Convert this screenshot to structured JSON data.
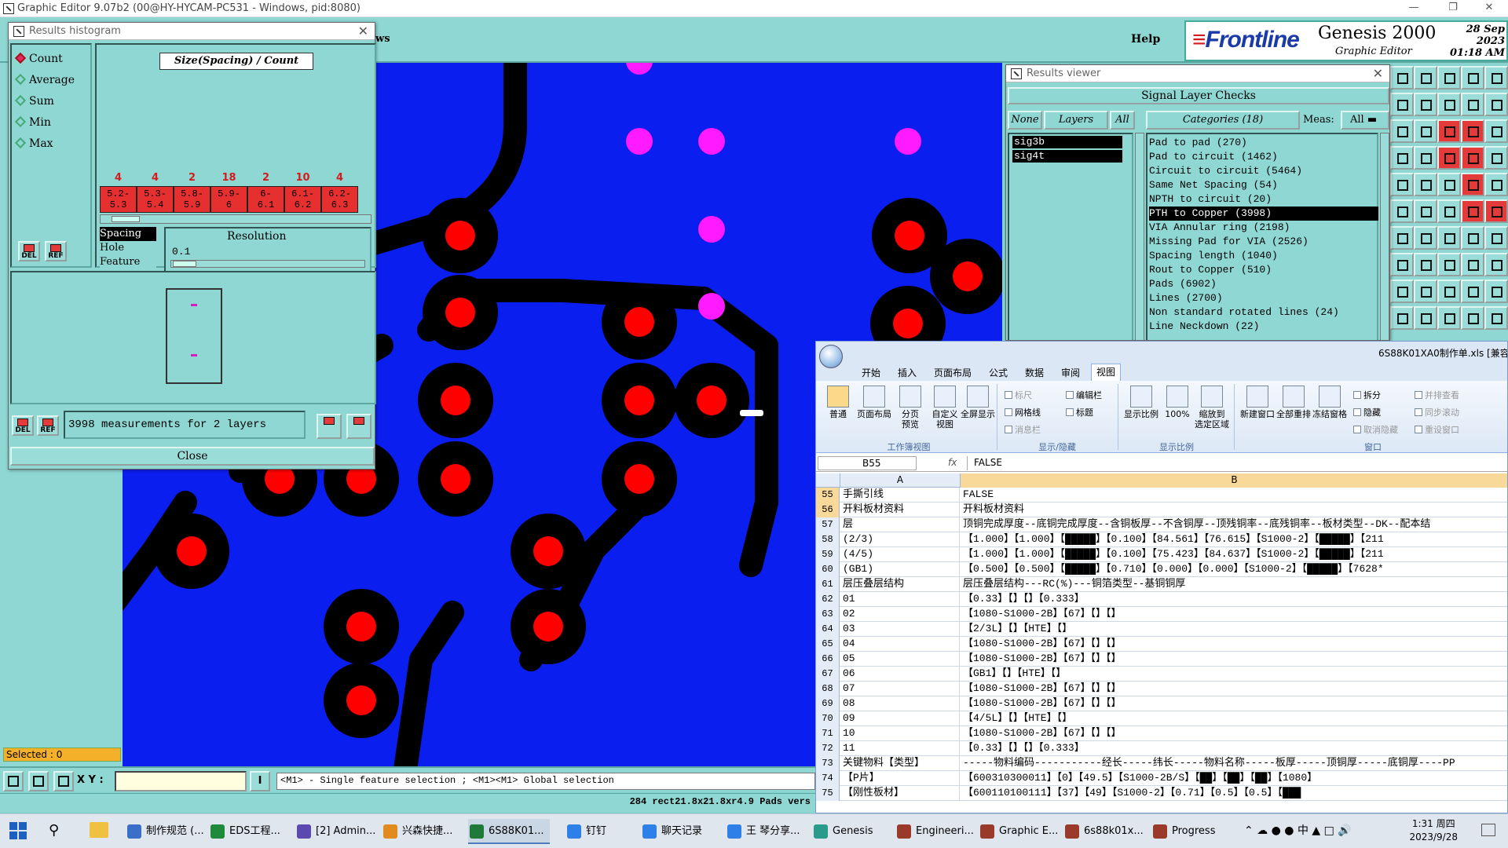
{
  "window": {
    "title": "Graphic Editor 9.07b2 (00@HY-HYCAM-PC531 - Windows, pid:8080)",
    "menu_partial": "ws",
    "help": "Help",
    "brand": "Frontline",
    "product": "Genesis 2000",
    "subtitle": "Graphic Editor",
    "date": "28 Sep 2023",
    "time": "01:18 AM"
  },
  "histogram": {
    "title": "Results histogram",
    "modes": [
      "Count",
      "Average",
      "Sum",
      "Min",
      "Max"
    ],
    "selected_mode": "Count",
    "chart_header": "Size(Spacing) / Count",
    "bins": [
      {
        "count": "4",
        "range_lo": "5.2-",
        "range_hi": "5.3"
      },
      {
        "count": "4",
        "range_lo": "5.3-",
        "range_hi": "5.4"
      },
      {
        "count": "2",
        "range_lo": "5.8-",
        "range_hi": "5.9"
      },
      {
        "count": "18",
        "range_lo": "5.9-",
        "range_hi": "6"
      },
      {
        "count": "2",
        "range_lo": "6-",
        "range_hi": "6.1"
      },
      {
        "count": "10",
        "range_lo": "6.1-",
        "range_hi": "6.2"
      },
      {
        "count": "4",
        "range_lo": "6.2-",
        "range_hi": "6.3"
      }
    ],
    "measure_types": [
      "Spacing",
      "Hole",
      "Feature"
    ],
    "selected_measure": "Spacing",
    "resolution_label": "Resolution",
    "resolution_value": "0.1",
    "btn_del": "DEL",
    "btn_ref": "REF",
    "measurements": "3998 measurements for 2 layers",
    "close": "Close"
  },
  "viewer": {
    "title": "Results viewer",
    "header": "Signal Layer Checks",
    "btn_none": "None",
    "btn_layers": "Layers",
    "btn_all": "All",
    "categories_header": "Categories (18)",
    "meas_label": "Meas:",
    "meas_value": "All",
    "layers": [
      "sig3b",
      "sig4t"
    ],
    "categories": [
      "Pad to pad (270)",
      "Pad to circuit (1462)",
      "Circuit to circuit (5464)",
      "Same Net Spacing (54)",
      "NPTH to circuit (20)",
      "PTH to Copper (3998)",
      "VIA Annular ring (2198)",
      "Missing Pad for VIA (2526)",
      "Spacing length (1040)",
      "Rout to Copper (510)",
      "Pads (6902)",
      "Lines (2700)",
      "Non standard rotated lines (24)",
      "Line Neckdown (22)"
    ],
    "selected_category": "PTH to Copper (3998)"
  },
  "bottom": {
    "selected": "Selected : 0",
    "xy_label": "X Y :",
    "info": "I",
    "hint": "<M1> - Single feature selection ; <M1><M1> Global selection",
    "status": "284 rect21.8x21.8xr4.9 Pads vers"
  },
  "excel": {
    "filename": "6S88K01XA0制作单.xls [兼容",
    "tabs": [
      "开始",
      "插入",
      "页面布局",
      "公式",
      "数据",
      "审阅",
      "视图"
    ],
    "active_tab": "视图",
    "ribbon": {
      "normal": "普通",
      "page_layout": "页面布局",
      "page_break": "分页\n预览",
      "custom_view": "自定义\n视图",
      "fullscreen": "全屏显示",
      "ruler": "标尺",
      "gridlines": "网格线",
      "msgbar": "消息栏",
      "formula_bar": "编辑栏",
      "headings": "标题",
      "zoom": "显示比例",
      "zoom100": "100%",
      "zoom_sel": "缩放到\n选定区域",
      "new_window": "新建窗口",
      "arrange": "全部重排",
      "freeze": "冻结窗格",
      "split": "拆分",
      "hide": "隐藏",
      "unhide": "取消隐藏",
      "side_by_side": "并排查看",
      "sync_scroll": "同步滚动",
      "reset_pos": "重设窗口",
      "grp_views": "工作簿视图",
      "grp_show": "显示/隐藏",
      "grp_zoom": "显示比例",
      "grp_window": "窗口"
    },
    "name_box": "B55",
    "fx": "fx",
    "formula_value": "FALSE",
    "col_a": "A",
    "col_b": "B",
    "rows": [
      {
        "n": "55",
        "a": "手撕引线",
        "b": "FALSE"
      },
      {
        "n": "56",
        "a": "开料板材资料",
        "b": "开料板材资料"
      },
      {
        "n": "57",
        "a": "层",
        "b": "顶铜完成厚度--底铜完成厚度--含铜板厚--不含铜厚--顶残铜率--底残铜率--板材类型--DK--配本结"
      },
      {
        "n": "58",
        "a": "(2/3)",
        "b": "【1.000】【1.000】【█████】【0.100】【84.561】【76.615】【S1000-2】【█████】【211"
      },
      {
        "n": "59",
        "a": "(4/5)",
        "b": "【1.000】【1.000】【█████】【0.100】【75.423】【84.637】【S1000-2】【█████】【211"
      },
      {
        "n": "60",
        "a": "(GB1)",
        "b": "【0.500】【0.500】【█████】【0.710】【0.000】【0.000】【S1000-2】【█████】【7628*"
      },
      {
        "n": "61",
        "a": "层压叠层结构",
        "b": "层压叠层结构---RC(%)---铜箔类型--基铜铜厚"
      },
      {
        "n": "62",
        "a": "01",
        "b": "【0.33】【】【】【0.333】"
      },
      {
        "n": "63",
        "a": "02",
        "b": "【1080-S1000-2B】【67】【】【】"
      },
      {
        "n": "64",
        "a": "03",
        "b": "【2/3L】【】【HTE】【】"
      },
      {
        "n": "65",
        "a": "04",
        "b": "【1080-S1000-2B】【67】【】【】"
      },
      {
        "n": "66",
        "a": "05",
        "b": "【1080-S1000-2B】【67】【】【】"
      },
      {
        "n": "67",
        "a": "06",
        "b": "【GB1】【】【HTE】【】"
      },
      {
        "n": "68",
        "a": "07",
        "b": "【1080-S1000-2B】【67】【】【】"
      },
      {
        "n": "69",
        "a": "08",
        "b": "【1080-S1000-2B】【67】【】【】"
      },
      {
        "n": "70",
        "a": "09",
        "b": "【4/5L】【】【HTE】【】"
      },
      {
        "n": "71",
        "a": "10",
        "b": "【1080-S1000-2B】【67】【】【】"
      },
      {
        "n": "72",
        "a": "11",
        "b": "【0.33】【】【】【0.333】"
      },
      {
        "n": "73",
        "a": "关键物料【类型】",
        "b": "-----物料编码-----------经长-----纬长-----物料名称-----板厚-----顶铜厚-----底铜厚----PP"
      },
      {
        "n": "74",
        "a": "【P片】",
        "b": "【600310300011】【0】【49.5】【S1000-2B/S】【██】【██】【██】【1080】"
      },
      {
        "n": "75",
        "a": "【刚性板材】",
        "b": "【600110100111】【37】【49】【S1000-2】【0.71】【0.5】【0.5】【███"
      }
    ]
  },
  "taskbar": {
    "items": [
      {
        "label": "制作规范 (...",
        "color": "#3b6fc7"
      },
      {
        "label": "EDS工程...",
        "color": "#1f8a3a"
      },
      {
        "label": "[2] Admin...",
        "color": "#5a4ab0"
      },
      {
        "label": "兴森快捷...",
        "color": "#e08a20"
      },
      {
        "label": "6S88K01...",
        "color": "#1f7a3a"
      },
      {
        "label": "钉钉",
        "color": "#2f7fe8"
      },
      {
        "label": "聊天记录",
        "color": "#2f7fe8"
      },
      {
        "label": "王  琴分享...",
        "color": "#2f7fe8"
      },
      {
        "label": "Genesis",
        "color": "#2a9a8a"
      },
      {
        "label": "Engineeri...",
        "color": "#9a3a2a"
      },
      {
        "label": "Graphic E...",
        "color": "#9a3a2a"
      },
      {
        "label": "6s88k01x...",
        "color": "#9a3a2a"
      },
      {
        "label": "Progress",
        "color": "#9a3a2a"
      }
    ],
    "active": "6S88K01...",
    "clock_time": "1:31 周四",
    "clock_date": "2023/9/28",
    "ime": "中"
  },
  "colors": {
    "canvas_blue": "#0b1ef0",
    "pad_red": "#ff0000",
    "magenta": "#ff1aff",
    "panel_teal": "#8fd7d3",
    "bar_red": "#e63030"
  }
}
